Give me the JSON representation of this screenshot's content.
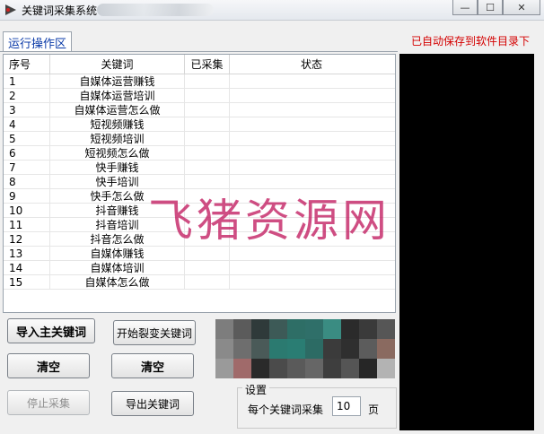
{
  "window": {
    "title": "关键词采集系统"
  },
  "window_controls": {
    "minimize": "—",
    "maximize": "☐",
    "close": "✕"
  },
  "tab": {
    "label": "运行操作区"
  },
  "status": {
    "autosave_notice": "已自动保存到软件目录下",
    "color": "#d40000"
  },
  "table": {
    "columns": [
      "序号",
      "关键词",
      "已采集",
      "状态"
    ],
    "rows": [
      {
        "no": "1",
        "keyword": "自媒体运营赚钱",
        "collected": "",
        "status": ""
      },
      {
        "no": "2",
        "keyword": "自媒体运营培训",
        "collected": "",
        "status": ""
      },
      {
        "no": "3",
        "keyword": "自媒体运营怎么做",
        "collected": "",
        "status": ""
      },
      {
        "no": "4",
        "keyword": "短视频赚钱",
        "collected": "",
        "status": ""
      },
      {
        "no": "5",
        "keyword": "短视频培训",
        "collected": "",
        "status": ""
      },
      {
        "no": "6",
        "keyword": "短视频怎么做",
        "collected": "",
        "status": ""
      },
      {
        "no": "7",
        "keyword": "快手赚钱",
        "collected": "",
        "status": ""
      },
      {
        "no": "8",
        "keyword": "快手培训",
        "collected": "",
        "status": ""
      },
      {
        "no": "9",
        "keyword": "快手怎么做",
        "collected": "",
        "status": ""
      },
      {
        "no": "10",
        "keyword": "抖音赚钱",
        "collected": "",
        "status": ""
      },
      {
        "no": "11",
        "keyword": "抖音培训",
        "collected": "",
        "status": ""
      },
      {
        "no": "12",
        "keyword": "抖音怎么做",
        "collected": "",
        "status": ""
      },
      {
        "no": "13",
        "keyword": "自媒体赚钱",
        "collected": "",
        "status": ""
      },
      {
        "no": "14",
        "keyword": "自媒体培训",
        "collected": "",
        "status": ""
      },
      {
        "no": "15",
        "keyword": "自媒体怎么做",
        "collected": "",
        "status": ""
      }
    ]
  },
  "buttons": {
    "import_main": "导入主关键词",
    "start_expand": "开始裂变关键词",
    "clear_left": "清空",
    "clear_right": "清空",
    "stop": "停止采集",
    "export": "导出关键词"
  },
  "settings": {
    "group_title": "设置",
    "per_keyword_label": "每个关键词采集",
    "pages_value": "10",
    "unit": "页"
  },
  "watermark": "飞猪资源网"
}
